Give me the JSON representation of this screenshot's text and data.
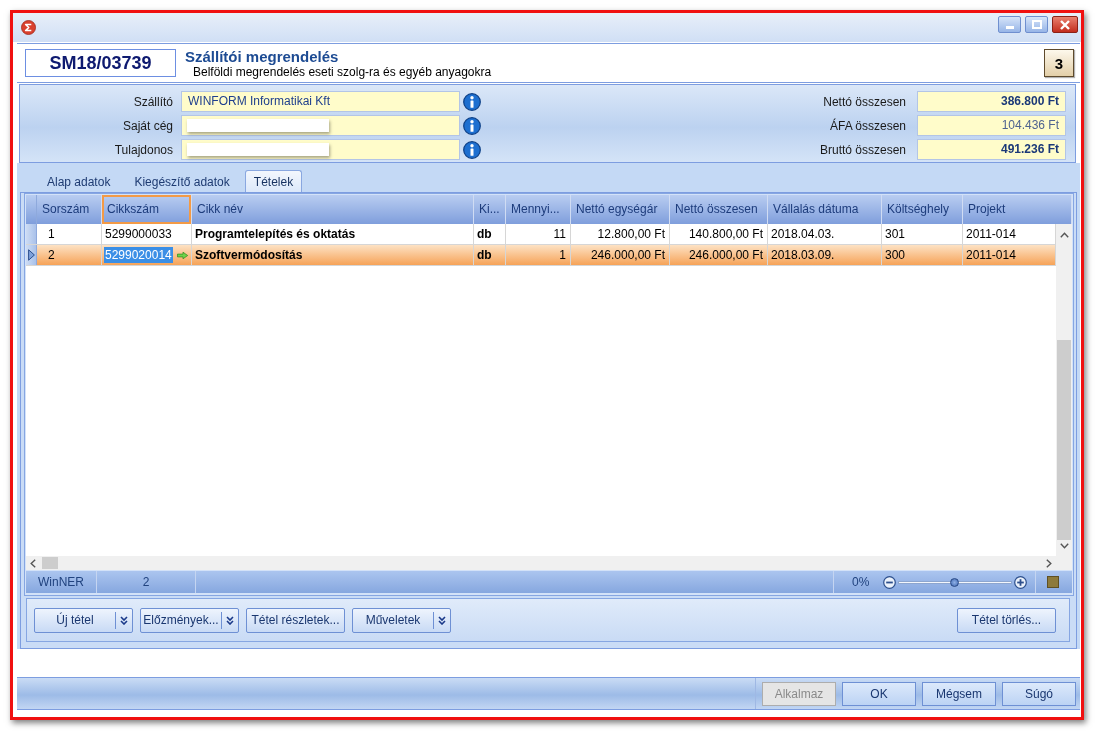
{
  "header": {
    "document_number": "SM18/03739",
    "title": "Szállítói megrendelés",
    "subtitle": "Belföldi megrendelés eseti szolg-ra és egyéb anyagokra",
    "counter": "3"
  },
  "parties": [
    {
      "label": "Szállító",
      "value": "WINFORM Informatikai Kft",
      "redacted": false
    },
    {
      "label": "Saját cég",
      "redacted": true
    },
    {
      "label": "Tulajdonos",
      "redacted": true
    }
  ],
  "totals": [
    {
      "label": "Nettó összesen",
      "value": "386.800 Ft",
      "emphasized": true
    },
    {
      "label": "ÁFA összesen",
      "value": "104.436 Ft",
      "emphasized": false
    },
    {
      "label": "Bruttó összesen",
      "value": "491.236 Ft",
      "emphasized": true
    }
  ],
  "tabs": [
    {
      "label": "Alap adatok",
      "selected": false
    },
    {
      "label": "Kiegészítő adatok",
      "selected": false
    },
    {
      "label": "Tételek",
      "selected": true
    }
  ],
  "table": {
    "columns": [
      {
        "label": "Sorszám",
        "focused": false
      },
      {
        "label": "Cikkszám",
        "focused": true
      },
      {
        "label": "Cikk név",
        "focused": false
      },
      {
        "label": "Ki...",
        "focused": false
      },
      {
        "label": "Mennyi...",
        "focused": false
      },
      {
        "label": "Nettó egységár",
        "focused": false
      },
      {
        "label": "Nettó összesen",
        "focused": false
      },
      {
        "label": "Vállalás dátuma",
        "focused": false
      },
      {
        "label": "Költséghely",
        "focused": false
      },
      {
        "label": "Projekt",
        "focused": false
      }
    ],
    "rows": [
      {
        "selected": false,
        "cells": [
          {
            "text": "1",
            "editing": false
          },
          {
            "text": "5299000033",
            "editing": false
          },
          {
            "text": "Programtelepítés és oktatás",
            "editing": false
          },
          {
            "text": "db",
            "editing": false
          },
          {
            "text": "11",
            "editing": false
          },
          {
            "text": "12.800,00 Ft",
            "editing": false
          },
          {
            "text": "140.800,00 Ft",
            "editing": false
          },
          {
            "text": "2018.04.03.",
            "editing": false
          },
          {
            "text": "301",
            "editing": false
          },
          {
            "text": "2011-014",
            "editing": false
          }
        ]
      },
      {
        "selected": true,
        "cells": [
          {
            "text": "2",
            "editing": false
          },
          {
            "text": "5299020014",
            "editing": true
          },
          {
            "text": "Szoftvermódosítás",
            "editing": false
          },
          {
            "text": "db",
            "editing": false
          },
          {
            "text": "1",
            "editing": false
          },
          {
            "text": "246.000,00 Ft",
            "editing": false
          },
          {
            "text": "246.000,00 Ft",
            "editing": false
          },
          {
            "text": "2018.03.09.",
            "editing": false
          },
          {
            "text": "300",
            "editing": false
          },
          {
            "text": "2011-014",
            "editing": false
          }
        ]
      }
    ]
  },
  "status_bar": {
    "app": "WinNER",
    "count": "2",
    "zoom_reading": "0%",
    "zoom": {
      "level": 0.5
    }
  },
  "actions": [
    {
      "label": "Új tétel",
      "dropdown": true
    },
    {
      "label": "Előzmények...",
      "dropdown": true
    },
    {
      "label": "Tétel részletek...",
      "dropdown": false
    },
    {
      "label": "Műveletek",
      "dropdown": true
    }
  ],
  "right_actions": [
    {
      "label": "Tétel törlés...",
      "dropdown": false
    }
  ],
  "dialog_buttons": [
    {
      "label": "Alkalmaz",
      "disabled": true
    },
    {
      "label": "OK",
      "disabled": false
    },
    {
      "label": "Mégsem",
      "disabled": false
    },
    {
      "label": "Súgó",
      "disabled": false
    }
  ]
}
